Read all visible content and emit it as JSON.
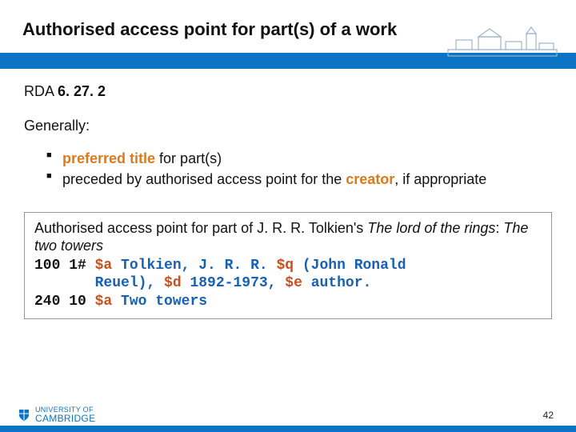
{
  "title": "Authorised access point for part(s) of a work",
  "rda_label": "RDA ",
  "rda_ref": "6. 27. 2",
  "generally": "Generally:",
  "bullets": {
    "b1_hl": "preferred title",
    "b1_rest": " for part(s)",
    "b2_pre": "preceded by authorised access point for the ",
    "b2_hl": "creator",
    "b2_post": ", if appropriate"
  },
  "example": {
    "prefix": "Authorised access point for part of J. R. R. Tolkien's ",
    "title_ital": "The lord of the rings",
    "sep": ": ",
    "part_ital": "The two towers",
    "marc": {
      "l1a": "100 1# ",
      "l1b": "$a",
      "l1c": " Tolkien, J. R. R. ",
      "l1d": "$q",
      "l1e": " (John Ronald",
      "l2a": "       ",
      "l2b": "",
      "l2c": "Reuel), ",
      "l2d": "$d",
      "l2e": " 1892-1973, ",
      "l2f": "$e",
      "l2g": " author.",
      "l3a": "240 10 ",
      "l3b": "$a",
      "l3c": " Two towers"
    }
  },
  "footer": {
    "logo_line1": "UNIVERSITY OF",
    "logo_line2": "CAMBRIDGE",
    "page": "42"
  }
}
